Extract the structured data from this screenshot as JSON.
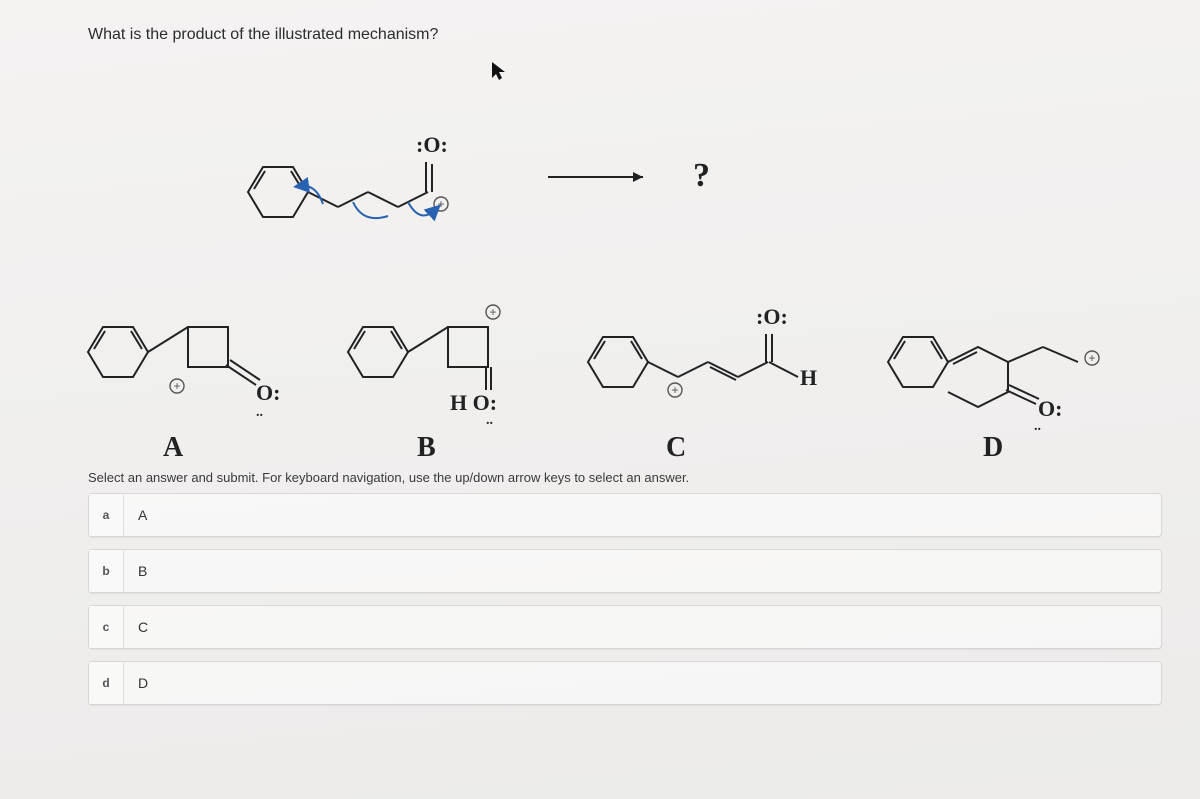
{
  "question": "What is the product of the illustrated mechanism?",
  "product_placeholder": "?",
  "structure_labels": {
    "a": "A",
    "b": "B",
    "c": "C",
    "d": "D"
  },
  "atoms": {
    "o_colon": "O:",
    "colon_o_colon": ":O:",
    "h": "H",
    "ho_colon": "H O:"
  },
  "instructions": "Select an answer and submit. For keyboard navigation, use the up/down arrow keys to select an answer.",
  "answers": [
    {
      "key": "a",
      "label": "A"
    },
    {
      "key": "b",
      "label": "B"
    },
    {
      "key": "c",
      "label": "C"
    },
    {
      "key": "d",
      "label": "D"
    }
  ]
}
